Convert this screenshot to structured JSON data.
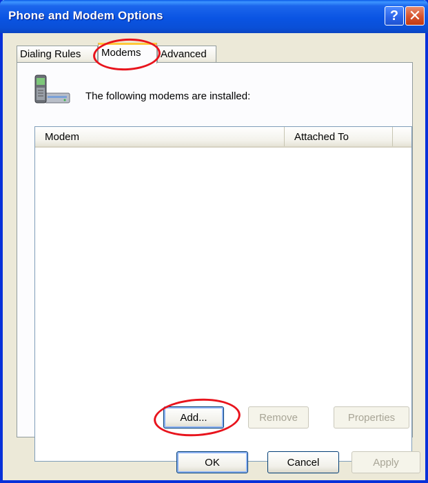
{
  "window": {
    "title": "Phone and Modem Options",
    "help_glyph": "?",
    "close_glyph": "✕",
    "title_color": "#ffffff",
    "titlebar_color": "#0a54e3"
  },
  "tabs": [
    {
      "label": "Dialing Rules",
      "active": false
    },
    {
      "label": "Modems",
      "active": true
    },
    {
      "label": "Advanced",
      "active": false
    }
  ],
  "modems_page": {
    "intro": "The following modems are  installed:",
    "icon": "phone-modem-icon",
    "columns": [
      "Modem",
      "Attached To"
    ],
    "rows": [],
    "buttons": {
      "add": "Add...",
      "remove": "Remove",
      "properties": "Properties"
    }
  },
  "dialog_buttons": {
    "ok": "OK",
    "cancel": "Cancel",
    "apply": "Apply"
  },
  "annotations": {
    "color": "#e8141d",
    "shape": "ellipse"
  }
}
